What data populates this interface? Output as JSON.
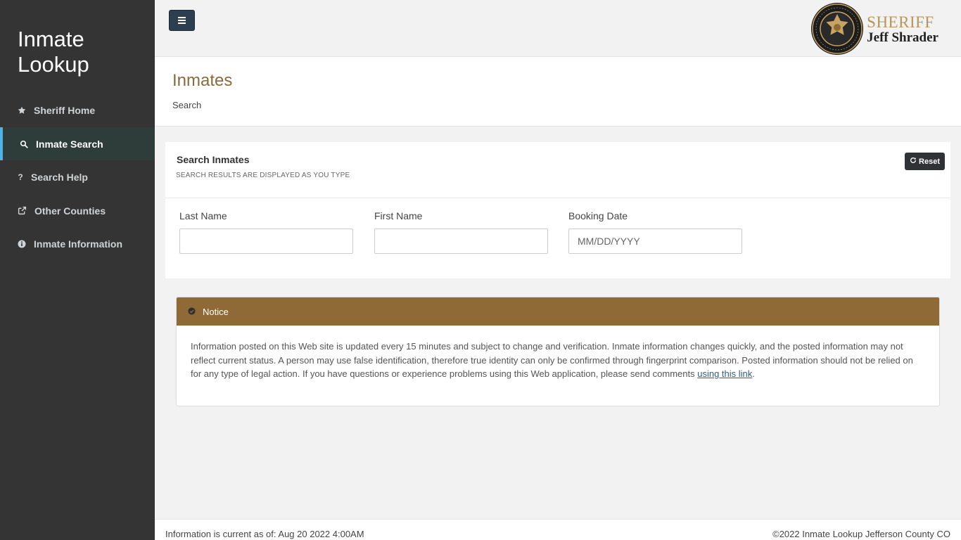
{
  "sidebar": {
    "brand_line1": "Inmate",
    "brand_line2": "Lookup",
    "items": [
      {
        "label": "Sheriff Home",
        "icon": "star-icon"
      },
      {
        "label": "Inmate Search",
        "icon": "search-icon",
        "active": true
      },
      {
        "label": "Search Help",
        "icon": "question-icon"
      },
      {
        "label": "Other Counties",
        "icon": "external-link-icon"
      },
      {
        "label": "Inmate Information",
        "icon": "info-circle-icon"
      }
    ]
  },
  "header": {
    "menu_icon": "hamburger-icon",
    "logo_line1": "SHERIFF",
    "logo_line2": "Jeff Shrader",
    "seal_text": "SHERIFF'S OFFICE · JEFFERSON COUNTY"
  },
  "page": {
    "title": "Inmates",
    "breadcrumb": "Search"
  },
  "search": {
    "title": "Search Inmates",
    "subtitle": "SEARCH RESULTS ARE DISPLAYED AS YOU TYPE",
    "reset_label": "Reset",
    "reset_icon": "refresh-icon",
    "fields": [
      {
        "label": "Last Name",
        "value": "",
        "placeholder": ""
      },
      {
        "label": "First Name",
        "value": "",
        "placeholder": ""
      },
      {
        "label": "Booking Date",
        "value": "",
        "placeholder": "MM/DD/YYYY"
      }
    ]
  },
  "notice": {
    "title": "Notice",
    "icon": "check-circle-icon",
    "body": "Information posted on this Web site is updated every 15 minutes and subject to change and verification. Inmate information changes quickly, and the posted information may not reflect current status. A person may use false identification, therefore true identity can only be confirmed through fingerprint comparison. Posted information should not be relied on for any type of legal action. If you have questions or experience problems using this Web application, please send comments ",
    "link_text": "using this link",
    "tail": "."
  },
  "footer": {
    "left": "Information is current as of: Aug 20 2022 4:00AM",
    "right": "©2022 Inmate Lookup Jefferson County CO"
  },
  "colors": {
    "sidebar_bg": "#343434",
    "active_accent": "#4fb3e4",
    "brand_gold": "#b8955a",
    "notice_header": "#906a36",
    "title_brown": "#8a6a3e"
  }
}
